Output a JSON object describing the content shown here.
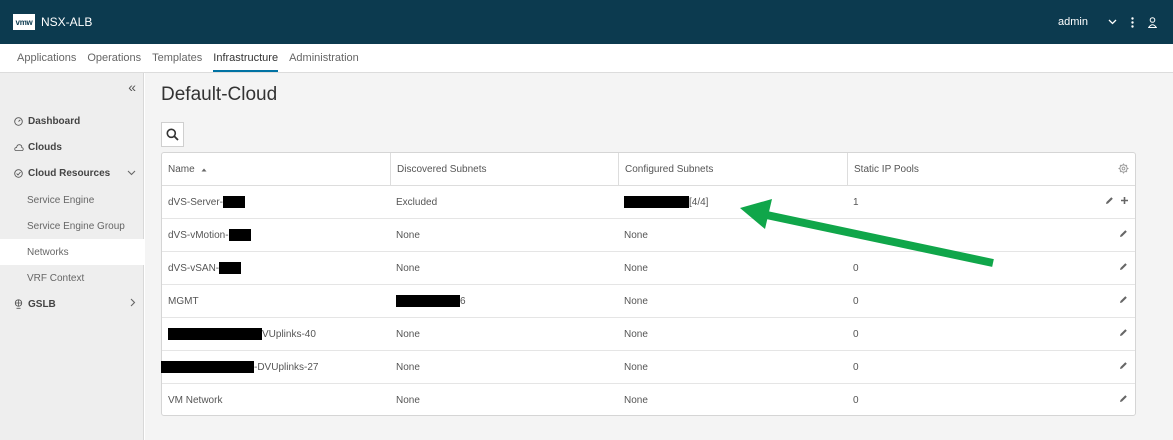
{
  "header": {
    "logo_text": "vmw",
    "app_title": "NSX-ALB",
    "user": "admin"
  },
  "nav": {
    "tabs": [
      {
        "label": "Applications"
      },
      {
        "label": "Operations"
      },
      {
        "label": "Templates"
      },
      {
        "label": "Infrastructure",
        "active": true
      },
      {
        "label": "Administration"
      }
    ]
  },
  "sidebar": {
    "collapse_glyph": "«",
    "items": [
      {
        "label": "Dashboard",
        "icon": "dashboard-icon"
      },
      {
        "label": "Clouds",
        "icon": "cloud-icon"
      },
      {
        "label": "Cloud Resources",
        "icon": "cloud-resources-icon",
        "expanded": true
      },
      {
        "label": "Service Engine"
      },
      {
        "label": "Service Engine Group"
      },
      {
        "label": "Networks",
        "active": true
      },
      {
        "label": "VRF Context"
      },
      {
        "label": "GSLB",
        "icon": "gslb-icon"
      }
    ]
  },
  "main": {
    "title": "Default-Cloud",
    "columns": {
      "name": "Name",
      "discovered": "Discovered Subnets",
      "configured": "Configured Subnets",
      "pools": "Static IP Pools"
    },
    "rows": [
      {
        "name": "dVS-Server-",
        "discovered": "Excluded",
        "configured": " [4/4]",
        "pools": "1"
      },
      {
        "name": "dVS-vMotion-",
        "discovered": "None",
        "configured": "None",
        "pools": ""
      },
      {
        "name": "dVS-vSAN-",
        "discovered": "None",
        "configured": "None",
        "pools": "0"
      },
      {
        "name": "MGMT",
        "discovered": "6",
        "configured": "None",
        "pools": "0"
      },
      {
        "name": "VUplinks-40",
        "discovered": "None",
        "configured": "None",
        "pools": "0"
      },
      {
        "name": "-DVUplinks-27",
        "discovered": "None",
        "configured": "None",
        "pools": "0"
      },
      {
        "name": "VM Network",
        "discovered": "None",
        "configured": "None",
        "pools": "0"
      }
    ]
  },
  "colors": {
    "header_bg": "#0c3a4f",
    "accent": "#0072a3",
    "arrow": "#10a64a"
  }
}
